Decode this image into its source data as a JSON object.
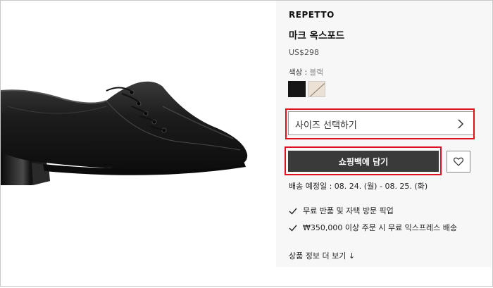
{
  "product": {
    "brand": "REPETTO",
    "name": "마크 옥스포드",
    "price": "US$298",
    "color_label": "색상 : ",
    "color_selected": "블랙",
    "swatches": [
      {
        "name": "black",
        "color": "#161616"
      },
      {
        "name": "beige",
        "color": "#ebe1d5"
      }
    ]
  },
  "size_select": {
    "label": "사이즈 선택하기"
  },
  "actions": {
    "add_to_cart": "쇼핑백에 담기"
  },
  "delivery": {
    "text": "배송 예정일 : 08. 24. (월) - 08. 25. (화)"
  },
  "benefits": [
    {
      "text": "무료 반품 및 자택 방문 픽업"
    },
    {
      "text": "₩350,000 이상 주문 시 무료 익스프레스 배송"
    }
  ],
  "more_info": {
    "text": "상품 정보 더 보기 ↓"
  },
  "colors": {
    "highlight": "#e0101f",
    "button_bg": "#3a3a3a",
    "panel_bg": "#f7f7f7"
  }
}
